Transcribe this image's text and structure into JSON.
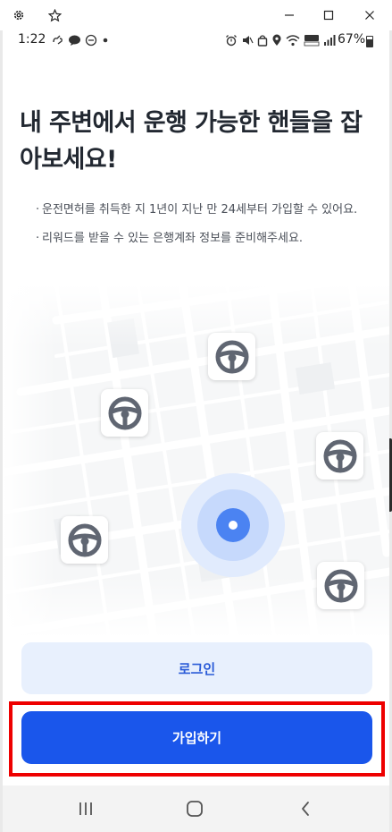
{
  "window": {
    "settings_icon": "gear-icon",
    "pin_icon": "star-icon",
    "minimize_icon": "minimize-icon",
    "maximize_icon": "maximize-icon",
    "close_icon": "close-icon"
  },
  "status_bar": {
    "time": "1:22",
    "battery": "67%",
    "left_icons": [
      "link-icon",
      "talk-icon",
      "dnd-icon",
      "dot-icon"
    ],
    "right_icons": [
      "alarm-icon",
      "mute-icon",
      "lock-icon",
      "location-icon",
      "wifi-icon",
      "volte-icon",
      "signal-icon"
    ]
  },
  "main": {
    "title": "내 주변에서 운행 가능한 핸들을 잡아보세요!",
    "notes": [
      "운전면허를 취득한 지 1년이 지난 만 24세부터 가입할 수 있어요.",
      "리워드를 받을 수 있는 은행계좌 정보를 준비해주세요."
    ],
    "bullet": "·"
  },
  "map": {
    "center_marker": "location-marker",
    "wheel_icon": "steering-wheel-icon",
    "wheel_count": 5
  },
  "buttons": {
    "login_label": "로그인",
    "signup_label": "가입하기"
  },
  "colors": {
    "primary": "#1a56eb",
    "login_bg": "#e8f0fd",
    "login_text": "#2a5bd7",
    "highlight": "#ee0000",
    "wheel": "#606672"
  },
  "nav": {
    "recents_icon": "recents-icon",
    "home_icon": "home-icon",
    "back_icon": "back-icon"
  }
}
